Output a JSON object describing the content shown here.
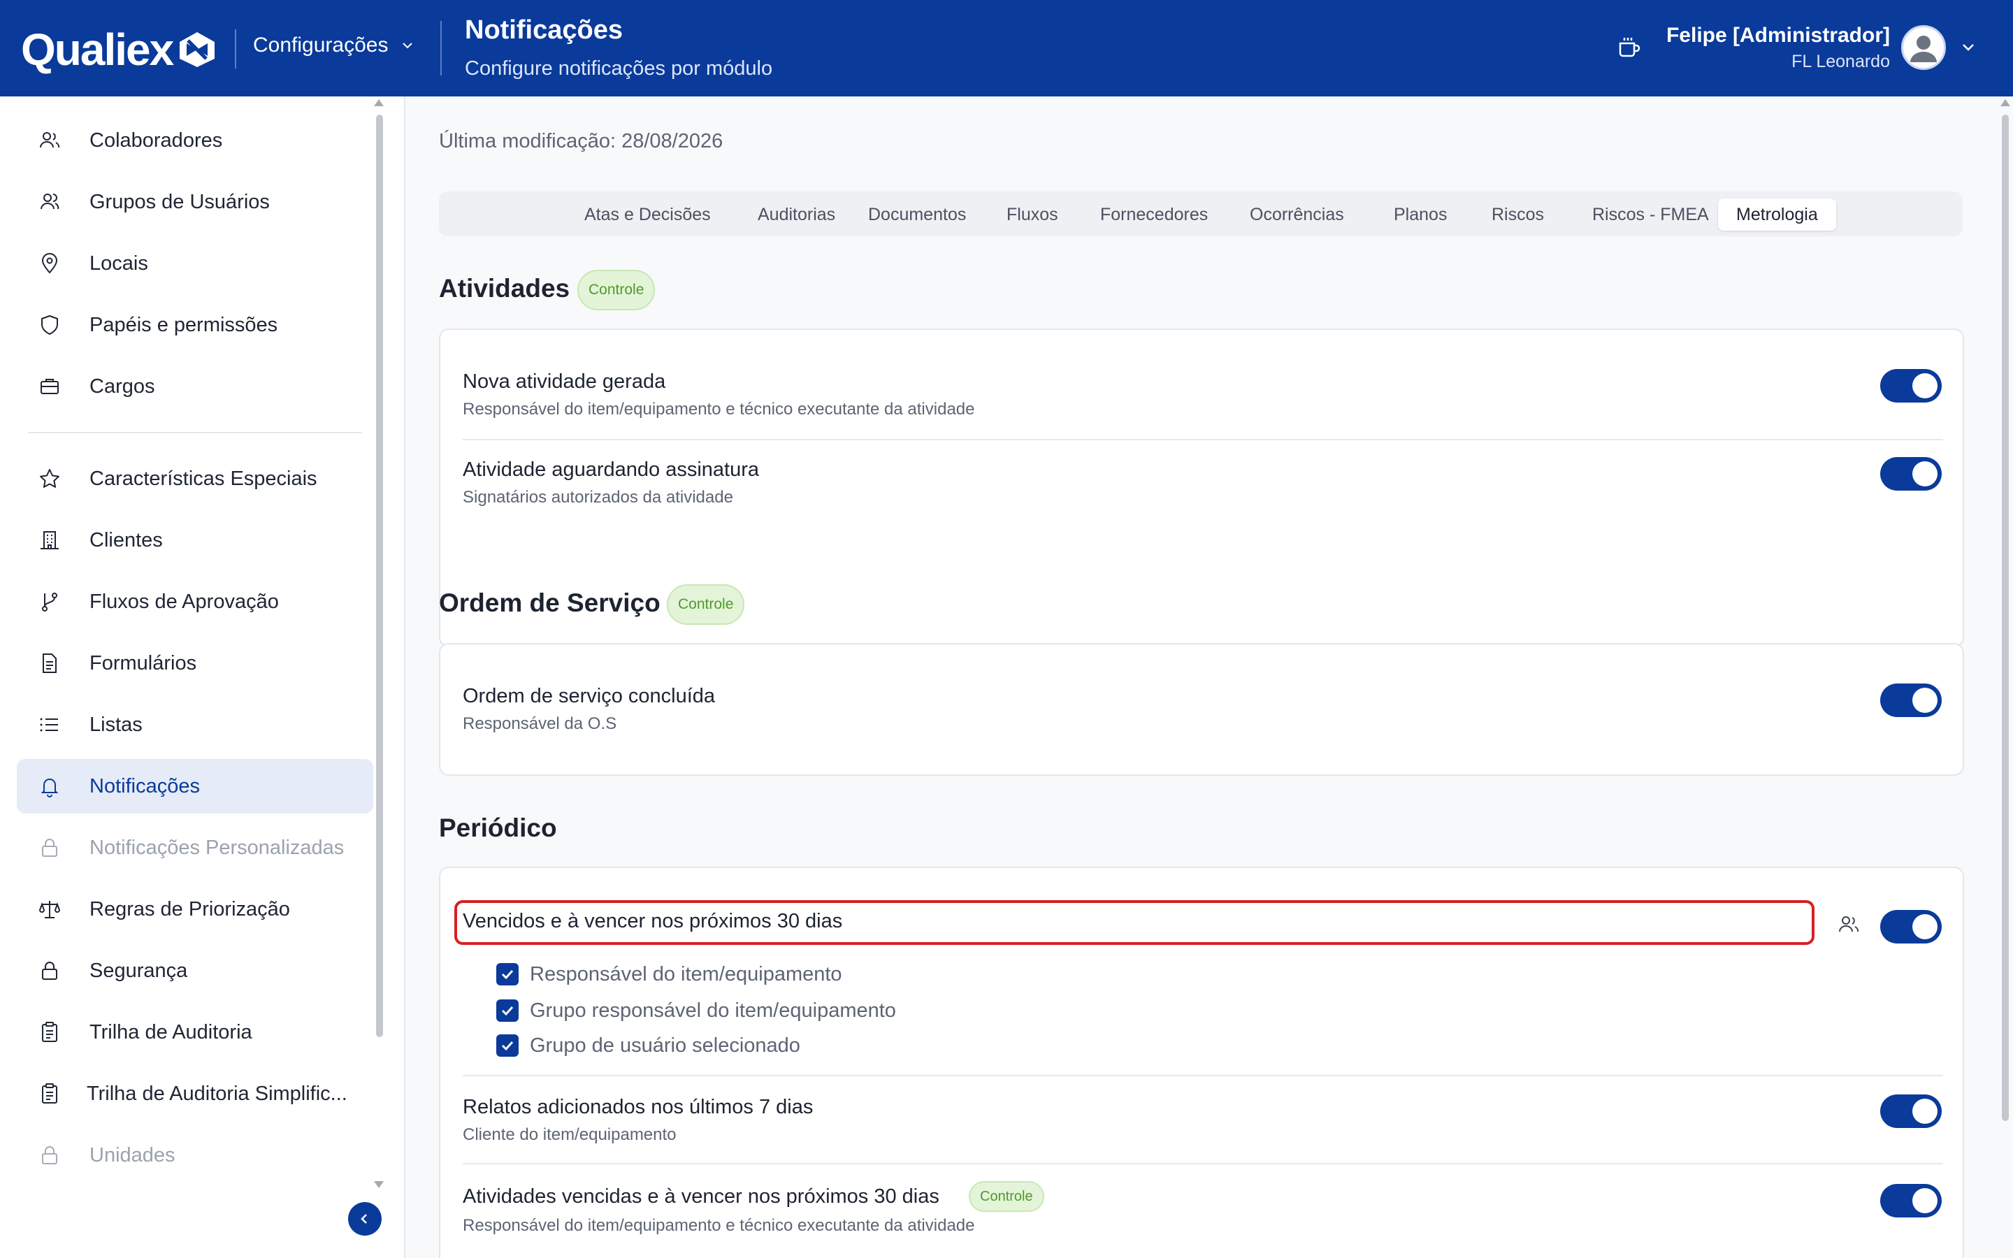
{
  "header": {
    "logo_text": "Qualiex",
    "module": "Configurações",
    "title": "Notificações",
    "subtitle": "Configure notificações por módulo",
    "user_name": "Felipe [Administrador]",
    "user_org": "FL Leonardo",
    "brand_color": "#0a3a9a"
  },
  "sidebar": {
    "items": [
      {
        "label": "Colaboradores",
        "icon": "users-icon"
      },
      {
        "label": "Grupos de Usuários",
        "icon": "user-group-icon"
      },
      {
        "label": "Locais",
        "icon": "map-pin-icon"
      },
      {
        "label": "Papéis e permissões",
        "icon": "shield-icon"
      },
      {
        "label": "Cargos",
        "icon": "briefcase-icon"
      },
      {
        "label": "Características Especiais",
        "icon": "star-icon"
      },
      {
        "label": "Clientes",
        "icon": "building-icon"
      },
      {
        "label": "Fluxos de Aprovação",
        "icon": "git-branch-icon"
      },
      {
        "label": "Formulários",
        "icon": "document-icon"
      },
      {
        "label": "Listas",
        "icon": "list-icon"
      },
      {
        "label": "Notificações",
        "icon": "bell-icon",
        "active": true
      },
      {
        "label": "Notificações Personalizadas",
        "icon": "lock-icon",
        "disabled": true
      },
      {
        "label": "Regras de Priorização",
        "icon": "scale-icon"
      },
      {
        "label": "Segurança",
        "icon": "lock-icon"
      },
      {
        "label": "Trilha de Auditoria",
        "icon": "clipboard-icon"
      },
      {
        "label": "Trilha de Auditoria Simplific...",
        "icon": "clipboard-icon"
      },
      {
        "label": "Unidades",
        "icon": "lock-icon",
        "disabled": true
      }
    ]
  },
  "main": {
    "last_modified": "Última modificação: 28/08/2026",
    "tabs": [
      {
        "label": "Atas e Decisões"
      },
      {
        "label": "Auditorias"
      },
      {
        "label": "Documentos"
      },
      {
        "label": "Fluxos"
      },
      {
        "label": "Fornecedores"
      },
      {
        "label": "Ocorrências"
      },
      {
        "label": "Planos"
      },
      {
        "label": "Riscos"
      },
      {
        "label": "Riscos - FMEA"
      },
      {
        "label": "Metrologia",
        "active": true
      }
    ],
    "sections": [
      {
        "title": "Atividades",
        "badge": "Controle",
        "rows": [
          {
            "title": "Nova atividade gerada",
            "subtitle": "Responsável do item/equipamento e técnico executante da atividade",
            "enabled": true
          },
          {
            "title": "Atividade aguardando assinatura",
            "subtitle": "Signatários autorizados da atividade",
            "enabled": true
          }
        ]
      },
      {
        "title": "Ordem de Serviço",
        "badge": "Controle",
        "rows": [
          {
            "title": "Ordem de serviço concluída",
            "subtitle": "Responsável da O.S",
            "enabled": true
          }
        ]
      },
      {
        "title": "Periódico",
        "rows": [
          {
            "title": "Vencidos e à vencer nos próximos 30 dias",
            "enabled": true,
            "options": [
              {
                "label": "Responsável do item/equipamento",
                "checked": true
              },
              {
                "label": "Grupo responsável do item/equipamento",
                "checked": true
              },
              {
                "label": "Grupo de usuário selecionado",
                "checked": true
              }
            ]
          },
          {
            "title": "Relatos adicionados nos últimos 7 dias",
            "subtitle": "Cliente do item/equipamento",
            "enabled": true
          },
          {
            "title": "Atividades vencidas e à vencer nos próximos 30 dias",
            "badge": "Controle",
            "subtitle": "Responsável do item/equipamento e técnico executante da atividade",
            "enabled": true
          }
        ]
      }
    ]
  }
}
